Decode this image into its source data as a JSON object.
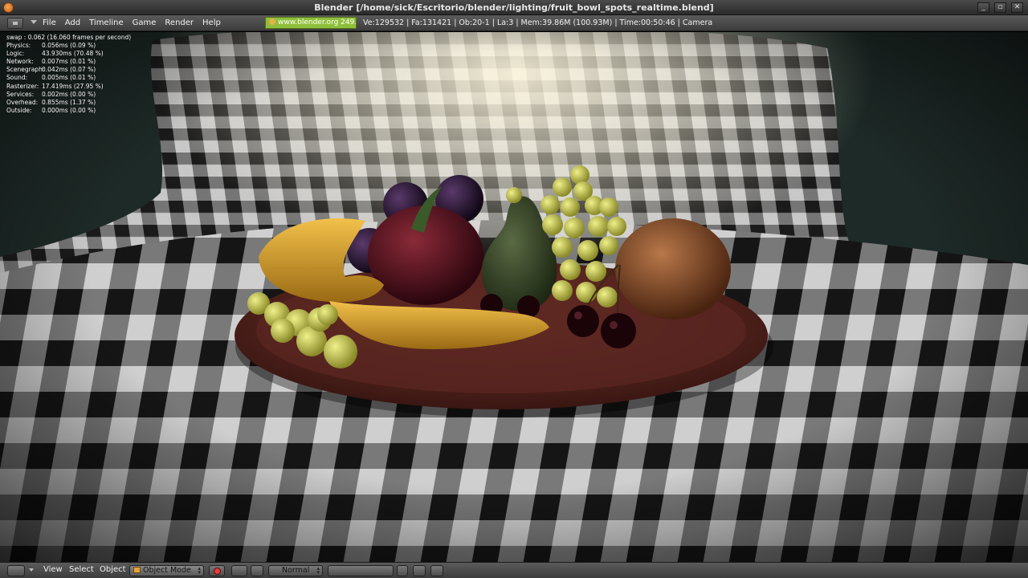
{
  "window": {
    "title": "Blender [/home/sick/Escritorio/blender/lighting/fruit_bowl_spots_realtime.blend]",
    "buttons": [
      "_",
      "▫",
      "✕"
    ]
  },
  "header": {
    "menu": [
      "File",
      "Add",
      "Timeline",
      "Game",
      "Render",
      "Help"
    ],
    "url_badge": "www.blender.org 249.2",
    "stats": "Ve:129532 | Fa:131421 | Ob:20-1 | La:3  | Mem:39.86M (100.93M)  | Time:00:50:46 | Camera"
  },
  "profile": {
    "swap": "swap : 0.062 (16.060 frames per second)",
    "rows": [
      {
        "k": "Physics:",
        "v": "0.056ms (0.09 %)"
      },
      {
        "k": "Logic:",
        "v": "43.930ms (70.48 %)"
      },
      {
        "k": "Network:",
        "v": "0.007ms (0.01 %)"
      },
      {
        "k": "Scenegraph:",
        "v": "0.042ms (0.07 %)"
      },
      {
        "k": "Sound:",
        "v": "0.005ms (0.01 %)"
      },
      {
        "k": "Rasterizer:",
        "v": "17.419ms (27.95 %)"
      },
      {
        "k": "Services:",
        "v": "0.002ms (0.00 %)"
      },
      {
        "k": "Overhead:",
        "v": "0.855ms (1.37 %)"
      },
      {
        "k": "Outside:",
        "v": "0.000ms (0.00 %)"
      }
    ]
  },
  "bottombar": {
    "view": "View",
    "select": "Select",
    "object": "Object",
    "mode": "Object Mode",
    "shading": "Normal"
  },
  "colors": {
    "url_badge": "#8fbf3a",
    "header_bg": "#4a4a4a",
    "plate": "#5a2a24",
    "banana": "#d9a12a",
    "grape": "#c6c75a",
    "apple": "#5a1420",
    "plum": "#2a1a3a",
    "pear": "#3a4a2a",
    "orange": "#8a5530"
  }
}
